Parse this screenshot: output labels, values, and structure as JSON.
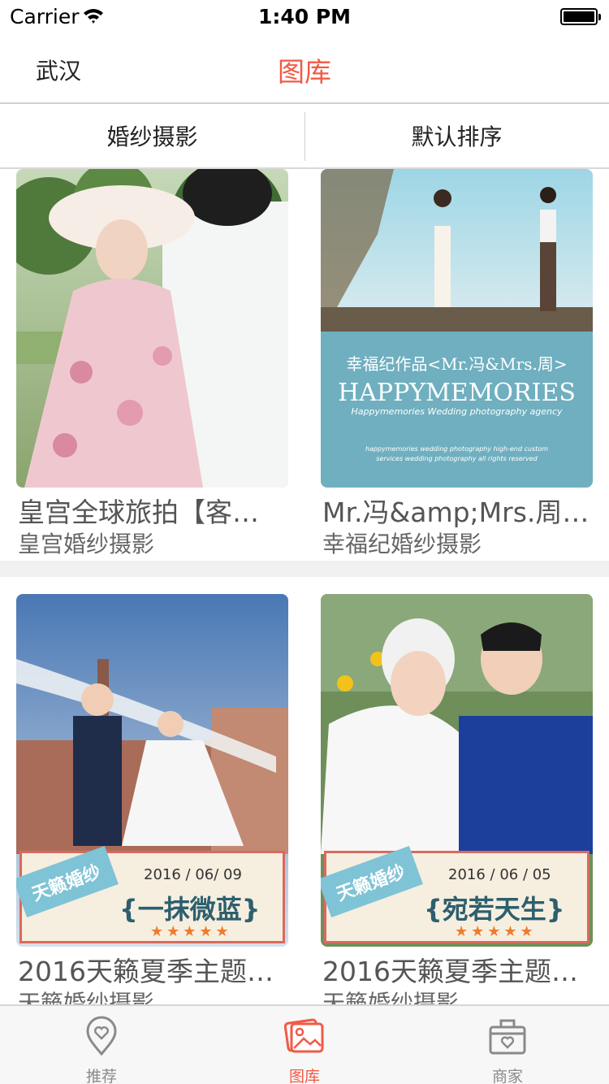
{
  "status_bar": {
    "carrier": "Carrier",
    "time": "1:40 PM"
  },
  "nav": {
    "city": "武汉",
    "title": "图库"
  },
  "filters": {
    "category": "婚纱摄影",
    "sort": "默认排序"
  },
  "cards": [
    {
      "title": "皇宫全球旅拍【客…",
      "subtitle": "皇宫婚纱摄影"
    },
    {
      "title": "Mr.冯&amp;Mrs.周…",
      "subtitle": "幸福纪婚纱摄影",
      "image_text": {
        "line1": "幸福纪作品<Mr.冯&Mrs.周>",
        "line2": "HAPPYMEMORIES",
        "line3": "Happymemories Wedding photography agency",
        "line4": "happymemories wedding photography high-end custom",
        "line5": "services wedding photography all rights reserved"
      }
    },
    {
      "title": "2016天籁夏季主题…",
      "subtitle": "天籁婚纱摄影",
      "banner": {
        "brand": "天籁婚纱",
        "date": "2016 / 06/ 09",
        "slogan": "{一抹微蓝}",
        "stars": "★★★★★"
      }
    },
    {
      "title": "2016天籁夏季主题…",
      "subtitle": "天籁婚纱摄影",
      "banner": {
        "brand": "天籁婚纱",
        "date": "2016 / 06 / 05",
        "slogan": "{宛若天生}",
        "stars": "★★★★★"
      }
    }
  ],
  "tabs": [
    {
      "label": "推荐",
      "icon": "heart-pin-icon",
      "active": false
    },
    {
      "label": "图库",
      "icon": "gallery-icon",
      "active": true
    },
    {
      "label": "商家",
      "icon": "shop-box-icon",
      "active": false
    }
  ],
  "colors": {
    "accent": "#f25a45",
    "tab_inactive": "#8a8a8a",
    "separator": "#f1f1f1"
  }
}
